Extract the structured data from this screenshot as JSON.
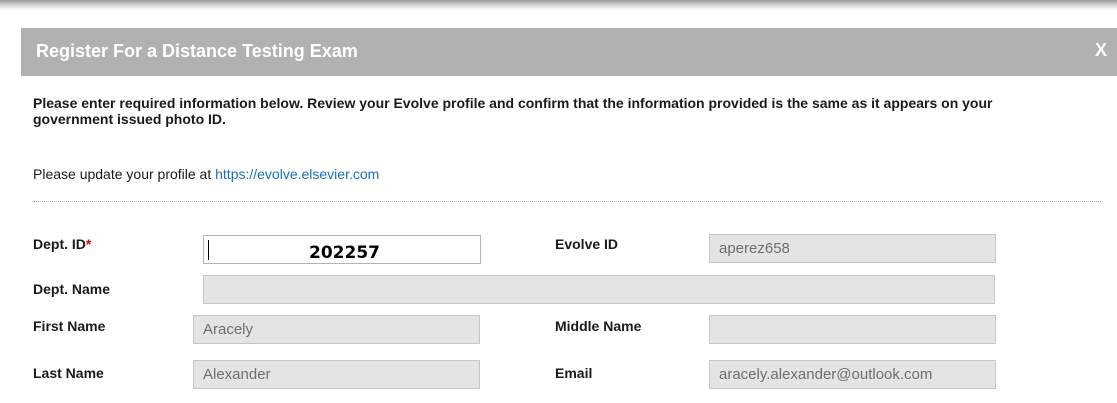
{
  "dialog": {
    "title": "Register For a Distance Testing Exam",
    "close_label": "X"
  },
  "instructions": "Please enter required information below. Review your Evolve profile and confirm that the information provided is the same as it appears on your government issued photo ID.",
  "profile_note": {
    "prefix": "Please update your profile at ",
    "link_text": "https://evolve.elsevier.com"
  },
  "form": {
    "dept_id": {
      "label": "Dept. ID",
      "required_mark": "*",
      "value": "202257"
    },
    "evolve_id": {
      "label": "Evolve ID",
      "value": "aperez658"
    },
    "dept_name": {
      "label": "Dept. Name",
      "value": ""
    },
    "first_name": {
      "label": "First Name",
      "value": "Aracely"
    },
    "middle_name": {
      "label": "Middle Name",
      "value": ""
    },
    "last_name": {
      "label": "Last Name",
      "value": "Alexander"
    },
    "email": {
      "label": "Email",
      "value": "aracely.alexander@outlook.com"
    }
  },
  "colors": {
    "header_bg": "#b1b1b1",
    "link": "#1a6fb5",
    "required": "#d40000",
    "readonly_field_bg": "#e4e4e4"
  }
}
